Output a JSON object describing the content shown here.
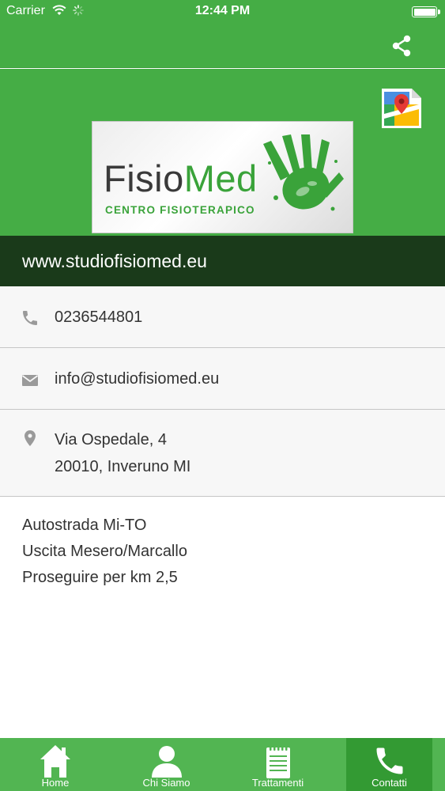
{
  "status_bar": {
    "carrier": "Carrier",
    "time": "12:44 PM"
  },
  "header": {
    "logo": {
      "part1": "Fisio",
      "part2": "Med",
      "subtitle": "CENTRO FISIOTERAPICO"
    }
  },
  "website": "www.studiofisiomed.eu",
  "contact": {
    "phone": "0236544801",
    "email": "info@studiofisiomed.eu",
    "address_line1": "Via Ospedale, 4",
    "address_line2": "20010, Inveruno MI"
  },
  "directions": [
    "Autostrada Mi-TO",
    "Uscita Mesero/Marcallo",
    "Proseguire per km 2,5"
  ],
  "tabs": [
    {
      "label": "Home",
      "icon": "home-icon",
      "active": false
    },
    {
      "label": "Chi Siamo",
      "icon": "person-icon",
      "active": false
    },
    {
      "label": "Trattamenti",
      "icon": "notepad-icon",
      "active": false
    },
    {
      "label": "Contatti",
      "icon": "phone-icon",
      "active": true
    }
  ],
  "colors": {
    "primary_green": "#45ad45",
    "dark_green": "#1a3a1a",
    "tab_bar": "#52b552",
    "tab_active": "#339a33",
    "row_bg": "#f7f7f7"
  }
}
